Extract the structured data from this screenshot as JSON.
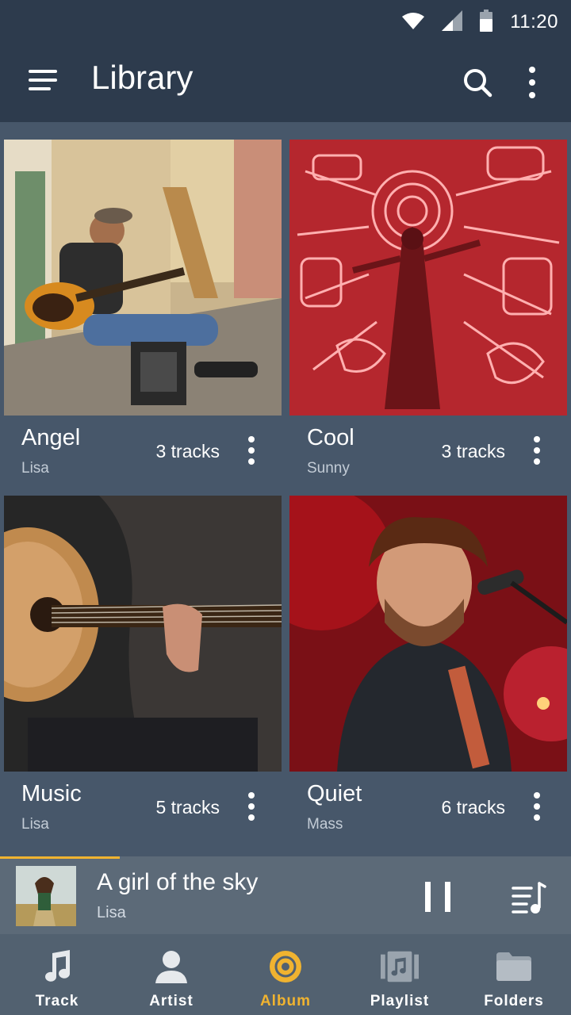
{
  "status_bar": {
    "time": "11:20",
    "icons": [
      "wifi-icon",
      "signal-icon",
      "battery-icon"
    ]
  },
  "app_bar": {
    "title": "Library",
    "icons": [
      "menu-icon",
      "search-icon",
      "more-vert-icon"
    ]
  },
  "albums": [
    {
      "name": "Angel",
      "artist": "Lisa",
      "tracks": "3 tracks",
      "art": "street-guitarist-photo"
    },
    {
      "name": "Cool",
      "artist": "Sunny",
      "tracks": "3 tracks",
      "art": "red-neon-instruments-photo"
    },
    {
      "name": "Music",
      "artist": "Lisa",
      "tracks": "5 tracks",
      "art": "acoustic-guitar-closeup-photo"
    },
    {
      "name": "Quiet",
      "artist": "Mass",
      "tracks": "6 tracks",
      "art": "singer-microphone-photo"
    }
  ],
  "now_playing": {
    "title": "A girl of the sky",
    "artist": "Lisa",
    "progress": 0.21,
    "art": "girl-in-field-photo"
  },
  "bottom_nav": {
    "items": [
      {
        "label": "Track",
        "icon": "music-note-icon",
        "active": false
      },
      {
        "label": "Artist",
        "icon": "person-icon",
        "active": false
      },
      {
        "label": "Album",
        "icon": "album-disc-icon",
        "active": true
      },
      {
        "label": "Playlist",
        "icon": "playlist-icon",
        "active": false
      },
      {
        "label": "Folders",
        "icon": "folder-icon",
        "active": false
      }
    ]
  },
  "colors": {
    "header_bg": "#2d3b4d",
    "grid_bg": "#47576a",
    "player_bg": "#5c6a78",
    "nav_bg": "#526170",
    "accent": "#f0b330"
  }
}
